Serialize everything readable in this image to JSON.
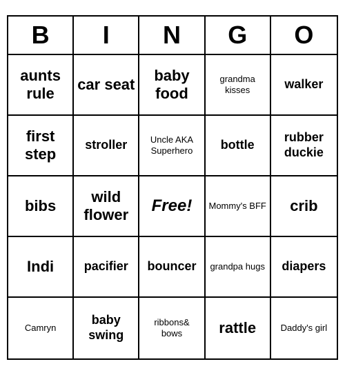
{
  "header": {
    "letters": [
      "B",
      "I",
      "N",
      "G",
      "O"
    ]
  },
  "cells": [
    {
      "text": "aunts rule",
      "size": "large"
    },
    {
      "text": "car seat",
      "size": "large"
    },
    {
      "text": "baby food",
      "size": "large"
    },
    {
      "text": "grandma kisses",
      "size": "small"
    },
    {
      "text": "walker",
      "size": "medium"
    },
    {
      "text": "first step",
      "size": "large"
    },
    {
      "text": "stroller",
      "size": "medium"
    },
    {
      "text": "Uncle AKA Superhero",
      "size": "small"
    },
    {
      "text": "bottle",
      "size": "medium"
    },
    {
      "text": "rubber duckie",
      "size": "medium"
    },
    {
      "text": "bibs",
      "size": "large"
    },
    {
      "text": "wild flower",
      "size": "large"
    },
    {
      "text": "Free!",
      "size": "free"
    },
    {
      "text": "Mommy's BFF",
      "size": "small"
    },
    {
      "text": "crib",
      "size": "large"
    },
    {
      "text": "Indi",
      "size": "large"
    },
    {
      "text": "pacifier",
      "size": "medium"
    },
    {
      "text": "bouncer",
      "size": "medium"
    },
    {
      "text": "grandpa hugs",
      "size": "small"
    },
    {
      "text": "diapers",
      "size": "medium"
    },
    {
      "text": "Camryn",
      "size": "small"
    },
    {
      "text": "baby swing",
      "size": "medium"
    },
    {
      "text": "ribbons& bows",
      "size": "small"
    },
    {
      "text": "rattle",
      "size": "large"
    },
    {
      "text": "Daddy's girl",
      "size": "small"
    }
  ]
}
